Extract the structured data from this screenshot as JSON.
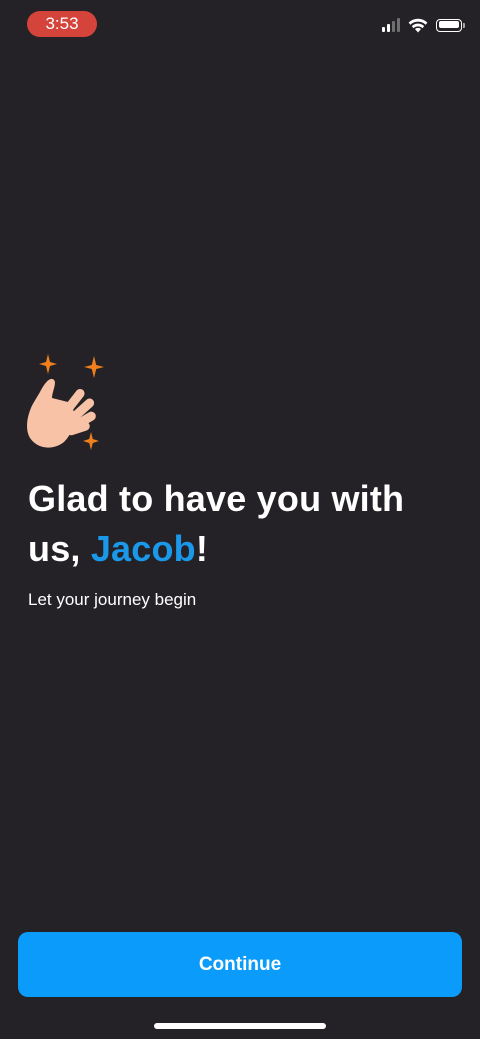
{
  "status_bar": {
    "time": "3:53",
    "signal_bars_active": 2,
    "signal_bars_total": 4,
    "battery_level": 1.0
  },
  "welcome": {
    "emoji_icon": "waving-hand-with-sparkles",
    "headline_prefix": "Glad to have you with us, ",
    "user_name": "Jacob",
    "headline_suffix": "!",
    "subtitle": "Let your journey begin"
  },
  "actions": {
    "continue_label": "Continue"
  },
  "colors": {
    "background": "#242226",
    "accent": "#1a98ea",
    "button": "#0a9bfb",
    "time_pill": "#d5443b",
    "sparkle": "#f07f1c",
    "hand": "#f7c2a6"
  }
}
